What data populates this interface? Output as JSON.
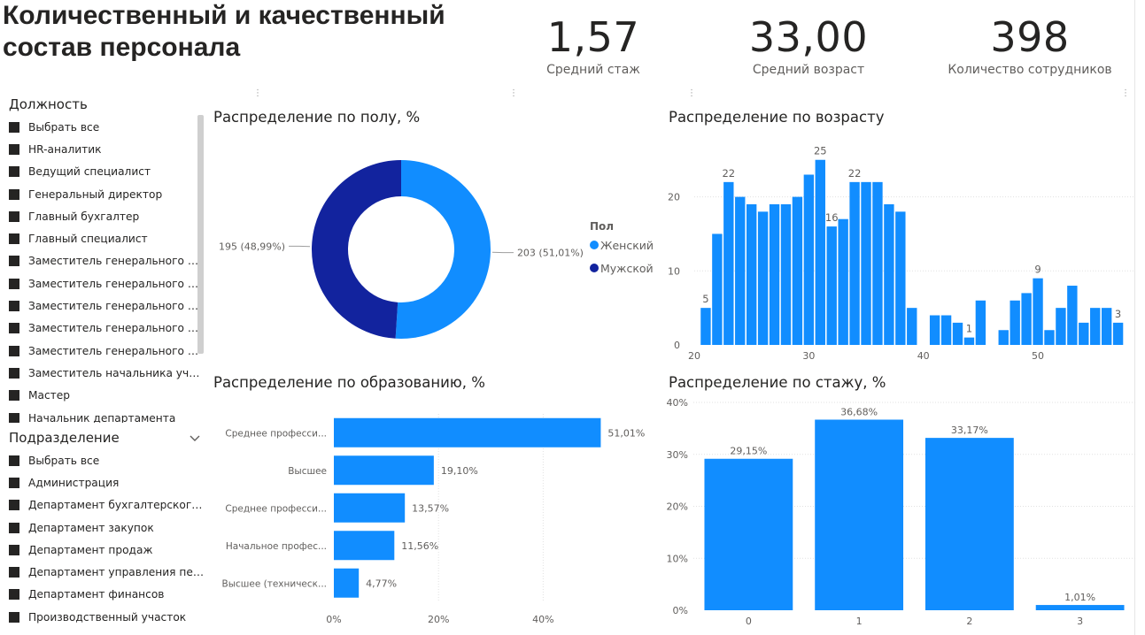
{
  "report": {
    "title": "Количественный и качественный состав персонала"
  },
  "kpis": [
    {
      "value": "1,57",
      "label": "Средний стаж"
    },
    {
      "value": "33,00",
      "label": "Средний возраст"
    },
    {
      "value": "398",
      "label": "Количество сотрудников"
    }
  ],
  "slicers": {
    "position": {
      "title": "Должность",
      "items": [
        "Выбрать все",
        "HR-аналитик",
        "Ведущий специалист",
        "Генеральный директор",
        "Главный бухгалтер",
        "Главный специалист",
        "Заместитель генерального ди...",
        "Заместитель генерального ди...",
        "Заместитель генерального ди...",
        "Заместитель генерального ди...",
        "Заместитель генерального ди...",
        "Заместитель начальника участ...",
        "Мастер",
        "Начальник департамента"
      ]
    },
    "department": {
      "title": "Подразделение",
      "items": [
        "Выбрать все",
        "Администрация",
        "Департамент бухгалтерского у...",
        "Департамент закупок",
        "Департамент продаж",
        "Департамент управления пер...",
        "Департамент финансов",
        "Производственный участок"
      ]
    }
  },
  "colors": {
    "primary_blue": "#118dff",
    "dark_blue": "#12239e",
    "text": "#252423",
    "muted": "#605e5c",
    "grid": "#e1e1e1"
  },
  "chart_data": [
    {
      "id": "gender",
      "type": "pie",
      "donut": true,
      "title": "Распределение по полу, %",
      "legend_title": "Пол",
      "legend_position": "right",
      "slices": [
        {
          "name": "Женский",
          "value": 203,
          "percent": 51.01,
          "label": "203 (51,01%)",
          "color": "#118dff"
        },
        {
          "name": "Мужской",
          "value": 195,
          "percent": 48.99,
          "label": "195 (48,99%)",
          "color": "#12239e"
        }
      ]
    },
    {
      "id": "age",
      "type": "bar",
      "title": "Распределение по возрасту",
      "x": [
        20,
        21,
        22,
        23,
        24,
        25,
        26,
        27,
        28,
        29,
        30,
        31,
        32,
        33,
        34,
        35,
        36,
        37,
        38,
        39,
        40,
        41,
        42,
        43,
        44,
        45,
        46,
        47,
        48,
        49,
        50,
        51,
        52,
        53,
        54,
        55,
        56,
        57,
        58
      ],
      "values": [
        0,
        5,
        15,
        22,
        20,
        19,
        18,
        19,
        19,
        20,
        23,
        25,
        16,
        17,
        22,
        22,
        22,
        19,
        18,
        5,
        0,
        4,
        4,
        3,
        1,
        6,
        0,
        2,
        6,
        7,
        9,
        2,
        5,
        8,
        3,
        5,
        5,
        3,
        0
      ],
      "data_labels": [
        {
          "x": 21,
          "text": "5"
        },
        {
          "x": 23,
          "text": "22"
        },
        {
          "x": 31,
          "text": "25"
        },
        {
          "x": 32,
          "text": "16"
        },
        {
          "x": 34,
          "text": "22"
        },
        {
          "x": 44,
          "text": "1"
        },
        {
          "x": 50,
          "text": "9"
        },
        {
          "x": 57,
          "text": "3"
        }
      ],
      "xticks": [
        "20",
        "30",
        "40",
        "50"
      ],
      "yticks": [
        "0",
        "10",
        "20"
      ],
      "ylim": [
        0,
        27
      ],
      "grid": true
    },
    {
      "id": "education",
      "type": "bar",
      "orientation": "horizontal",
      "title": "Распределение по образованию, %",
      "categories": [
        "Среднее професси...",
        "Высшее",
        "Среднее професси...",
        "Начальное профес...",
        "Высшее (техническ..."
      ],
      "values": [
        51.01,
        19.1,
        13.57,
        11.56,
        4.77
      ],
      "value_labels": [
        "51,01%",
        "19,10%",
        "13,57%",
        "11,56%",
        "4,77%"
      ],
      "xticks": [
        "0%",
        "20%",
        "40%"
      ],
      "xlim": [
        0,
        55
      ],
      "grid": true
    },
    {
      "id": "tenure",
      "type": "bar",
      "title": "Распределение по стажу, %",
      "categories": [
        "0",
        "1",
        "2",
        "3"
      ],
      "values": [
        29.15,
        36.68,
        33.17,
        1.01
      ],
      "value_labels": [
        "29,15%",
        "36,68%",
        "33,17%",
        "1,01%"
      ],
      "yticks": [
        "0%",
        "10%",
        "20%",
        "30%",
        "40%"
      ],
      "ylim": [
        0,
        40
      ],
      "grid": true
    }
  ]
}
